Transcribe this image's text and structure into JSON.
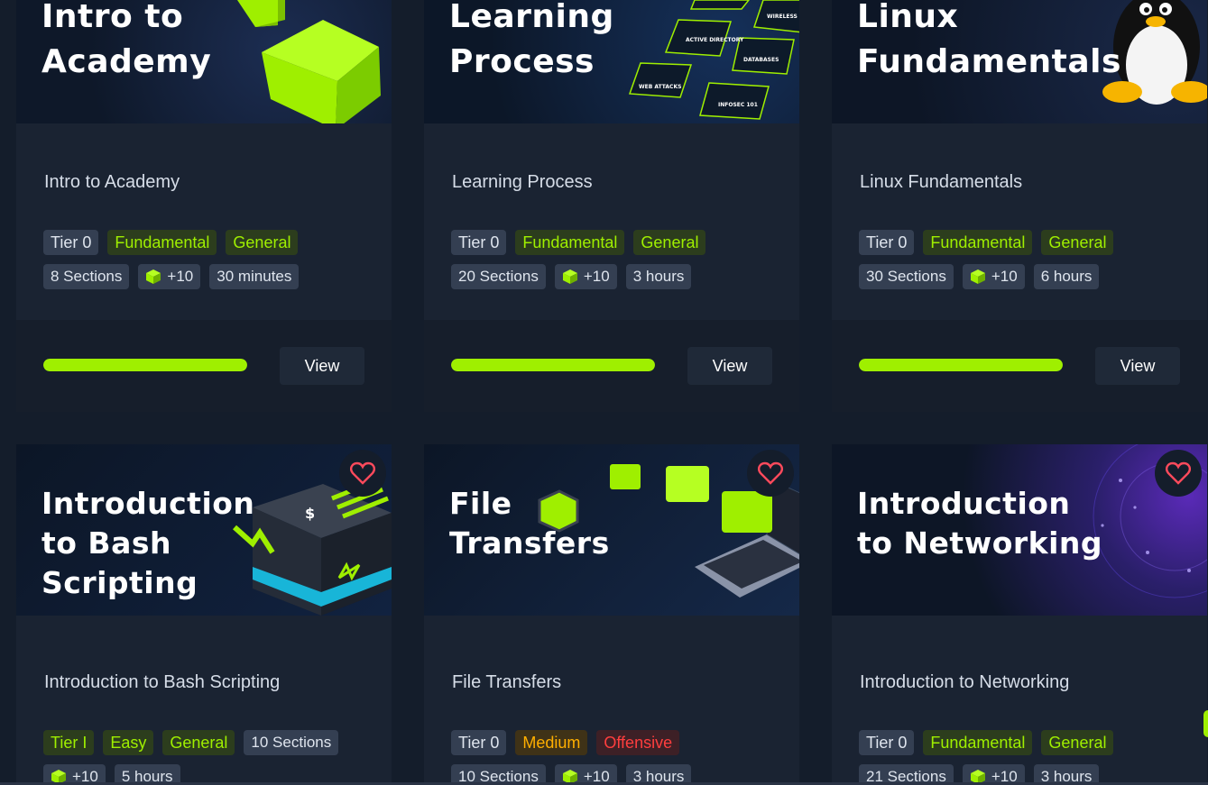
{
  "colors": {
    "accent": "#9fef00",
    "background": "#141d2b",
    "card": "#1a2332",
    "medium": "#ffaf00",
    "offensive": "#ff3e3e"
  },
  "cards": [
    {
      "banner_title": "Intro to\nAcademy",
      "title": "Intro to Academy",
      "tier": "Tier 0",
      "difficulty": "Fundamental",
      "category": "General",
      "sections": "8 Sections",
      "cubes": "+10",
      "duration": "30 minutes",
      "progress": 1.0,
      "view_label": "View"
    },
    {
      "banner_title": "Learning\nProcess",
      "title": "Learning Process",
      "tier": "Tier 0",
      "difficulty": "Fundamental",
      "category": "General",
      "sections": "20 Sections",
      "cubes": "+10",
      "duration": "3 hours",
      "progress": 1.0,
      "view_label": "View",
      "banner_labels": [
        "WIRELESS",
        "ACTIVE DIRECTORY",
        "DATABASES",
        "WEB ATTACKS",
        "INFOSEC 101"
      ]
    },
    {
      "banner_title": "Linux\nFundamentals",
      "title": "Linux Fundamentals",
      "tier": "Tier 0",
      "difficulty": "Fundamental",
      "category": "General",
      "sections": "30 Sections",
      "cubes": "+10",
      "duration": "6 hours",
      "progress": 1.0,
      "view_label": "View"
    },
    {
      "banner_title": "Introduction\nto Bash\nScripting",
      "title": "Introduction to Bash Scripting",
      "tier": "Tier I",
      "difficulty": "Easy",
      "category": "General",
      "sections": "10 Sections",
      "cubes": "+10",
      "duration": "5 hours",
      "banner_glyph": "$"
    },
    {
      "banner_title": "File\nTransfers",
      "title": "File Transfers",
      "tier": "Tier 0",
      "difficulty": "Medium",
      "category": "Offensive",
      "sections": "10 Sections",
      "cubes": "+10",
      "duration": "3 hours"
    },
    {
      "banner_title": "Introduction\nto Networking",
      "title": "Introduction to Networking",
      "tier": "Tier 0",
      "difficulty": "Fundamental",
      "category": "General",
      "sections": "21 Sections",
      "cubes": "+10",
      "duration": "3 hours"
    }
  ],
  "icons": {
    "favorite": "heart-icon",
    "cube": "cube-icon"
  }
}
